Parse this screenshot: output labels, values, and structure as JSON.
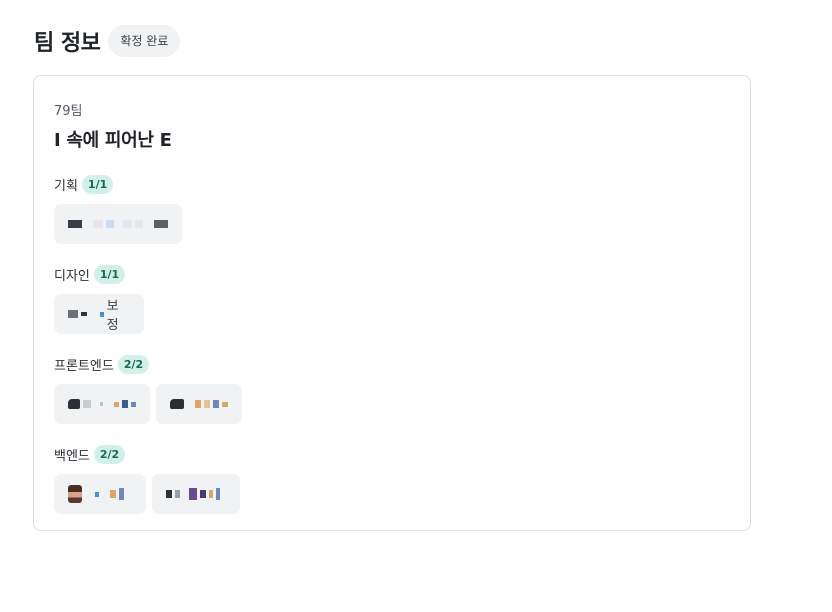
{
  "header": {
    "title": "팀 정보",
    "status": "확정 완료"
  },
  "team": {
    "number": "79팀",
    "name": "I 속에 피어난 E"
  },
  "roles": [
    {
      "label": "기획",
      "count": "1/1"
    },
    {
      "label": "디자인",
      "count": "1/1",
      "member_suffix": "보정"
    },
    {
      "label": "프론트엔드",
      "count": "2/2"
    },
    {
      "label": "백엔드",
      "count": "2/2"
    }
  ],
  "colors": {
    "badge_bg": "#f1f2f4",
    "count_bg": "#d3f0e8",
    "count_text": "#166b55",
    "chip_bg": "#f1f2f4"
  }
}
